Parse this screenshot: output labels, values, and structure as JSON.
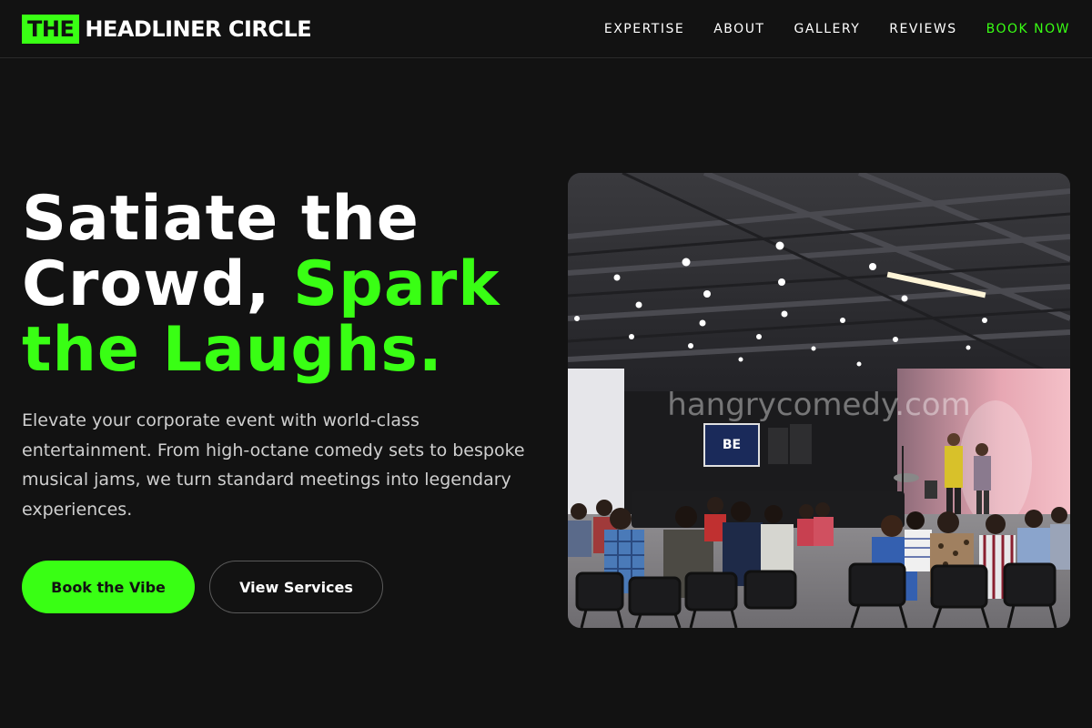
{
  "header": {
    "logo_mark": "THE",
    "logo_text": "HEADLINER CIRCLE",
    "nav": [
      {
        "label": "EXPERTISE"
      },
      {
        "label": "ABOUT"
      },
      {
        "label": "GALLERY"
      },
      {
        "label": "REVIEWS"
      },
      {
        "label": "BOOK NOW"
      }
    ]
  },
  "hero": {
    "title_line1": "Satiate the",
    "title_line2_white": "Crowd,",
    "title_line2_accent": "Spark",
    "title_line3_accent": "the Laughs.",
    "description": "Elevate your corporate event with world-class entertainment. From high-octane comedy sets to bespoke musical jams, we turn standard meetings into legendary experiences.",
    "primary_button": "Book the Vibe",
    "secondary_button": "View Services",
    "image": {
      "watermark": "hangrycomedy.com",
      "screen_text": "BE"
    }
  },
  "colors": {
    "background": "#121212",
    "accent": "#39ff14",
    "text": "#ffffff",
    "muted_text": "#cfcfcf"
  }
}
